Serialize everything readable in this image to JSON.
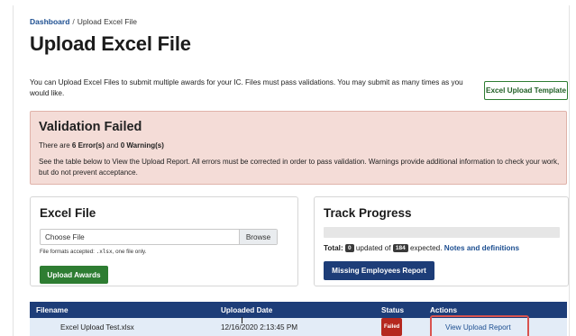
{
  "breadcrumb": {
    "home": "Dashboard",
    "separator": "/",
    "current": "Upload Excel File"
  },
  "page": {
    "title": "Upload Excel File",
    "intro": "You can Upload Excel Files to submit multiple awards for your IC. Files must pass validations. You may submit as many times as you would like.",
    "template_button": "Excel Upload Template"
  },
  "alert": {
    "title": "Validation Failed",
    "count_prefix": "There are ",
    "errors": "6 Error(s)",
    "count_mid": " and ",
    "warnings": "0 Warning(s)",
    "body": "See the table below to View the Upload Report. All errors must be corrected in order to pass validation. Warnings provide additional information to check your work, but do not prevent acceptance."
  },
  "excel_card": {
    "title": "Excel File",
    "file_placeholder": "Choose File",
    "browse_label": "Browse",
    "formats_prefix": "File formats accepted: ",
    "formats_ext": ".xlsx",
    "formats_suffix": ", one file only.",
    "upload_button": "Upload Awards"
  },
  "track_card": {
    "title": "Track Progress",
    "progress_fraction": 0,
    "total_label": "Total:",
    "updated_count": "0",
    "updated_text": "updated of",
    "expected_count": "184",
    "expected_text": "expected.",
    "notes_link": "Notes and definitions",
    "missing_button": "Missing Employees Report"
  },
  "table": {
    "headers": [
      "Filename",
      "Uploaded Date",
      "Status",
      "Actions"
    ],
    "rows": [
      {
        "filename": "Excel Upload Test.xlsx",
        "date": "12/16/2020 2:13:45 PM",
        "status": "Failed",
        "action": "View Upload Report"
      }
    ]
  },
  "colors": {
    "primary_navy": "#1d3d78",
    "success_green": "#2e7d32",
    "alert_bg": "#f4dcd7",
    "failed_red": "#b5281f",
    "highlight_red": "#d9534f",
    "link_blue": "#1d4f91"
  }
}
